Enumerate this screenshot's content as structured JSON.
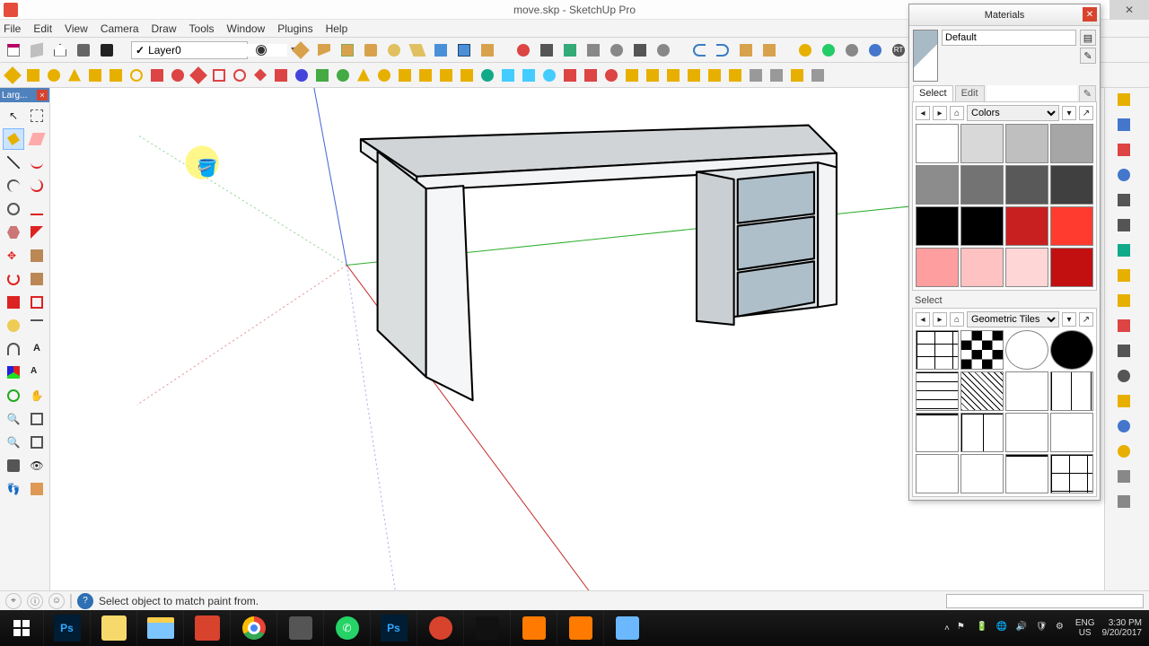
{
  "title": "move.skp - SketchUp Pro",
  "menus": [
    "File",
    "Edit",
    "View",
    "Camera",
    "Draw",
    "Tools",
    "Window",
    "Plugins",
    "Help"
  ],
  "layer": "Layer0",
  "leftdock_title": "Larg...",
  "status_msg": "Select object to match paint from.",
  "materials": {
    "title": "Materials",
    "default_name": "Default",
    "tabs": [
      "Select",
      "Edit"
    ],
    "lib1": "Colors",
    "lib2": "Geometric Tiles",
    "section_label": "Select",
    "colors": [
      "#ffffff",
      "#d8d8d8",
      "#bfbfbf",
      "#a6a6a6",
      "#8c8c8c",
      "#737373",
      "#595959",
      "#404040",
      "#000000",
      "#000000",
      "#c82020",
      "#ff3b30",
      "#ff9e9e",
      "#ffc2c2",
      "#ffd6d6",
      "#c21010"
    ]
  },
  "tray": {
    "lang1": "ENG",
    "lang2": "US",
    "time": "3:30 PM",
    "date": "9/20/2017"
  }
}
